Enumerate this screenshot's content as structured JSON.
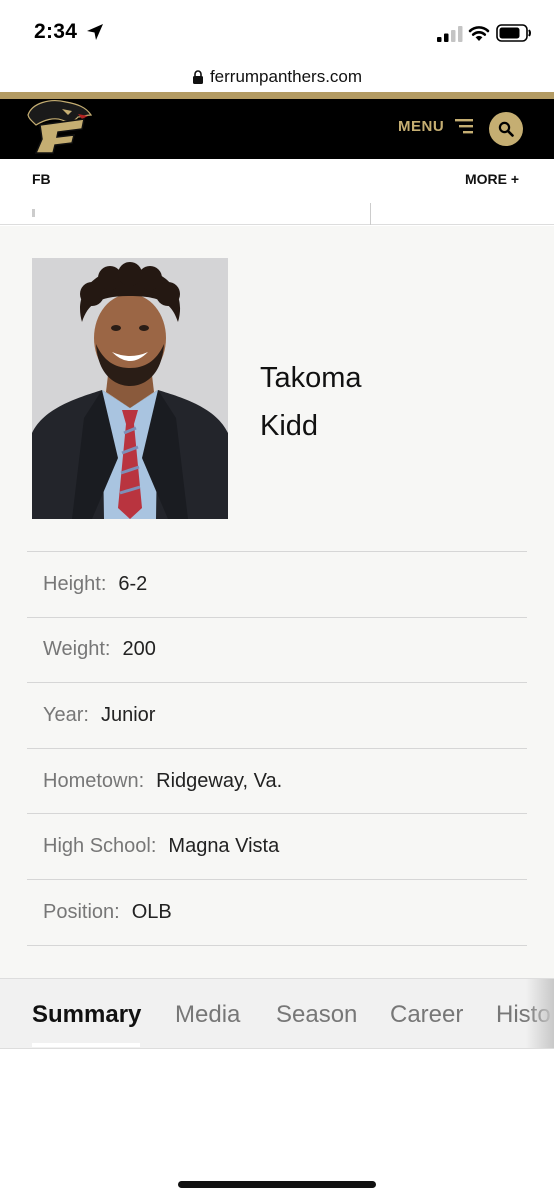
{
  "status_bar": {
    "time": "2:34",
    "icons": [
      "location-arrow-icon",
      "cellular-signal-icon",
      "wifi-icon",
      "battery-icon"
    ]
  },
  "browser": {
    "url": "ferrumpanthers.com"
  },
  "header": {
    "menu_label": "MENU",
    "brand_color": "#c5ae72"
  },
  "sub_nav": {
    "sport": "FB",
    "more": "MORE +"
  },
  "player": {
    "first_name": "Takoma",
    "last_name": "Kidd",
    "bio": [
      {
        "label": "Height:",
        "value": "6-2"
      },
      {
        "label": "Weight:",
        "value": "200"
      },
      {
        "label": "Year:",
        "value": "Junior"
      },
      {
        "label": "Hometown:",
        "value": "Ridgeway, Va."
      },
      {
        "label": "High School:",
        "value": "Magna Vista"
      },
      {
        "label": "Position:",
        "value": "OLB"
      }
    ]
  },
  "tabs": [
    {
      "label": "Summary",
      "active": true
    },
    {
      "label": "Media",
      "active": false
    },
    {
      "label": "Season",
      "active": false
    },
    {
      "label": "Career",
      "active": false
    },
    {
      "label": "Histo",
      "active": false
    }
  ]
}
